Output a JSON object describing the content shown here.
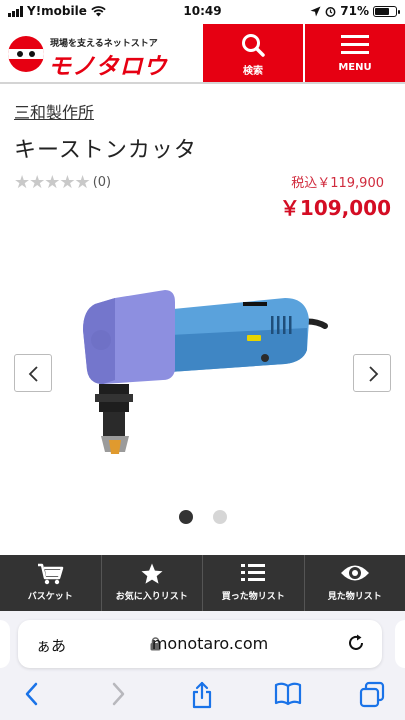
{
  "status_bar": {
    "carrier": "Y!mobile",
    "time": "10:49",
    "battery": "71%",
    "battery_level": 0.71
  },
  "header": {
    "logo_tagline": "現場を支えるネットストア",
    "logo_name": "モノタロウ",
    "search_label": "検索",
    "menu_label": "MENU"
  },
  "product": {
    "brand": "三和製作所",
    "title": "キーストンカッタ",
    "rating_stars": 0,
    "review_count": "(0)",
    "original_price": "税込￥119,900",
    "sale_price": "￥109,000"
  },
  "gallery": {
    "image_count": 2,
    "active_index": 0
  },
  "action_bar": {
    "basket": "バスケット",
    "favorites": "お気に入りリスト",
    "purchased": "買った物リスト",
    "viewed": "見た物リスト"
  },
  "browser": {
    "aa": "ぁあ",
    "url": "monotaro.com"
  },
  "colors": {
    "brand_red": "#e60012",
    "price_red": "#d40d24",
    "action_bar_bg": "#333333"
  }
}
